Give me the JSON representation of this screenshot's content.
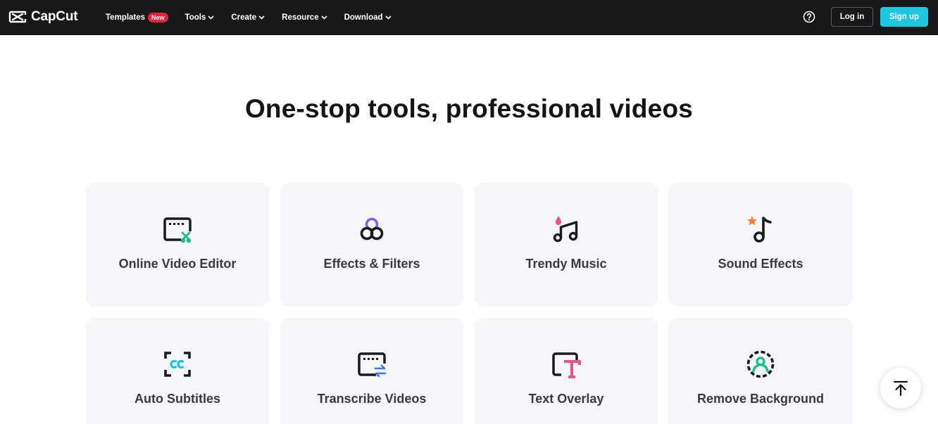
{
  "header": {
    "logo_text": "CapCut",
    "nav": [
      {
        "label": "Templates",
        "badge": "New",
        "dropdown": false
      },
      {
        "label": "Tools",
        "dropdown": true
      },
      {
        "label": "Create",
        "dropdown": true
      },
      {
        "label": "Resource",
        "dropdown": true
      },
      {
        "label": "Download",
        "dropdown": true
      }
    ],
    "help_icon": "question-circle-icon",
    "login_label": "Log in",
    "signup_label": "Sign up"
  },
  "main": {
    "title": "One-stop tools, professional videos",
    "tools": [
      {
        "label": "Online Video Editor",
        "icon": "video-editor-icon"
      },
      {
        "label": "Effects & Filters",
        "icon": "effects-filters-icon"
      },
      {
        "label": "Trendy Music",
        "icon": "music-notes-icon"
      },
      {
        "label": "Sound Effects",
        "icon": "sound-effects-icon"
      },
      {
        "label": "Auto Subtitles",
        "icon": "subtitles-cc-icon"
      },
      {
        "label": "Transcribe Videos",
        "icon": "transcribe-icon"
      },
      {
        "label": "Text Overlay",
        "icon": "text-overlay-icon"
      },
      {
        "label": "Remove Background",
        "icon": "remove-background-icon"
      }
    ]
  },
  "back_to_top_icon": "arrow-up-to-top-icon",
  "colors": {
    "header_bg": "#18181b",
    "signup_bg": "#1fc6e0",
    "badge_bg": "#e5243b",
    "card_bg": "#f4f6fa",
    "accent_green": "#1bbf8a",
    "accent_purple": "#8b5cf6",
    "accent_pink": "#f0508a",
    "accent_orange": "#ff7a2e",
    "accent_cyan": "#18c5e6",
    "accent_blue": "#3a7bf5"
  }
}
